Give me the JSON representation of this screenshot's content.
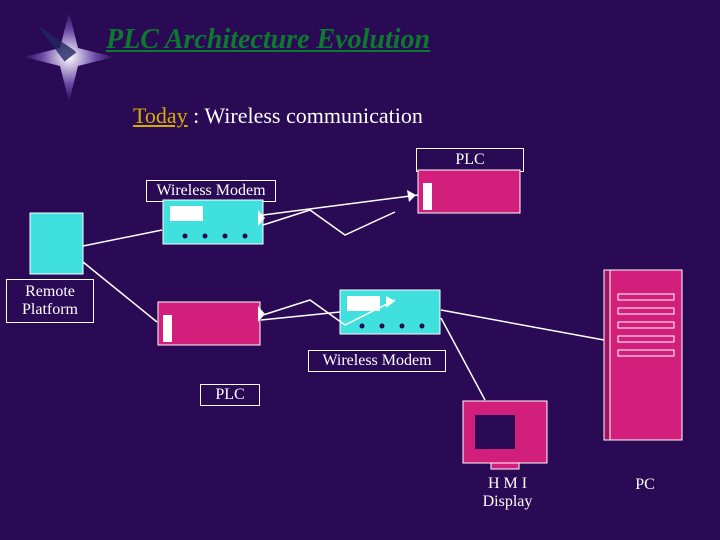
{
  "title": "PLC Architecture Evolution",
  "subtitle": {
    "today": "Today",
    "rest": " : Wireless communication"
  },
  "labels": {
    "plc_top": "PLC",
    "plc_bottom": "PLC",
    "wireless_modem_top": "Wireless Modem",
    "wireless_modem_bottom": "Wireless Modem",
    "remote_platform": "Remote Platform",
    "hmi_display": "H M I Display",
    "pc": "PC"
  },
  "colors": {
    "bg": "#2a0a54",
    "title_green": "#0b7a2e",
    "gold": "#d6ae00",
    "magenta": "#d21f7c",
    "cyan": "#3fe0dd",
    "white": "#ffffff"
  },
  "chart_data": {
    "type": "diagram",
    "title": "PLC Architecture Evolution — Today: Wireless communication",
    "nodes": [
      {
        "id": "plc_top",
        "label": "PLC"
      },
      {
        "id": "wireless_modem_1",
        "label": "Wireless Modem"
      },
      {
        "id": "remote_platform",
        "label": "Remote Platform"
      },
      {
        "id": "plc_bottom",
        "label": "PLC"
      },
      {
        "id": "wireless_modem_2",
        "label": "Wireless Modem"
      },
      {
        "id": "hmi_display",
        "label": "H M I Display"
      },
      {
        "id": "pc",
        "label": "PC"
      }
    ],
    "links": [
      {
        "from": "plc_top",
        "to": "wireless_modem_1",
        "type": "wire"
      },
      {
        "from": "wireless_modem_1",
        "to": "wireless_modem_2",
        "type": "wireless"
      },
      {
        "from": "remote_platform",
        "to": "plc_bottom",
        "type": "wire"
      },
      {
        "from": "plc_bottom",
        "to": "wireless_modem_2",
        "type": "wire"
      },
      {
        "from": "wireless_modem_2",
        "to": "hmi_display",
        "type": "wire"
      },
      {
        "from": "wireless_modem_2",
        "to": "pc",
        "type": "wire"
      }
    ]
  }
}
